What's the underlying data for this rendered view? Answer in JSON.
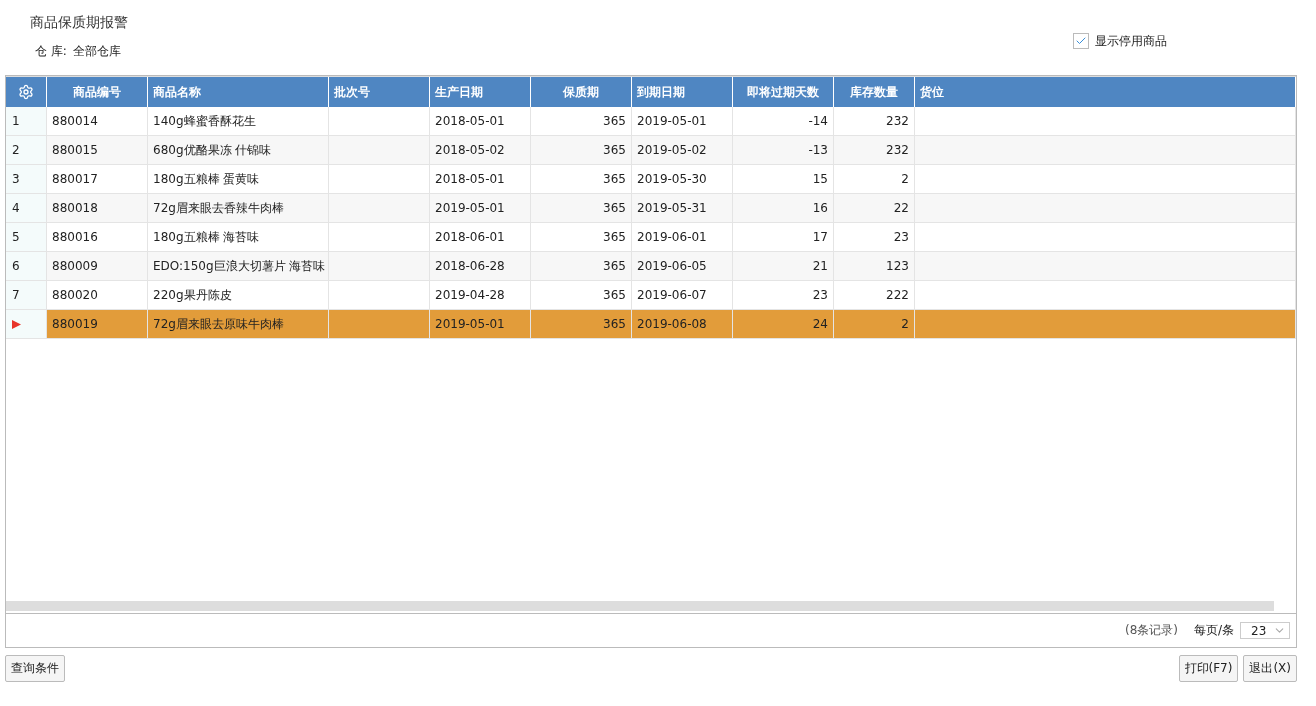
{
  "title": "商品保质期报警",
  "warehouse": {
    "label": "仓 库:",
    "value": "全部仓库"
  },
  "show_disabled": {
    "label": "显示停用商品",
    "checked": true
  },
  "table": {
    "columns": [
      "商品编号",
      "商品名称",
      "批次号",
      "生产日期",
      "保质期",
      "到期日期",
      "即将过期天数",
      "库存数量",
      "货位"
    ],
    "rows": [
      {
        "number": "1",
        "selected": false,
        "cells": [
          "880014",
          "140g蜂蜜香酥花生",
          "",
          "2018-05-01",
          "365",
          "2019-05-01",
          "-14",
          "232",
          ""
        ]
      },
      {
        "number": "2",
        "selected": false,
        "cells": [
          "880015",
          "680g优酪果冻 什锦味",
          "",
          "2018-05-02",
          "365",
          "2019-05-02",
          "-13",
          "232",
          ""
        ]
      },
      {
        "number": "3",
        "selected": false,
        "cells": [
          "880017",
          "180g五粮棒 蛋黄味",
          "",
          "2018-05-01",
          "365",
          "2019-05-30",
          "15",
          "2",
          ""
        ]
      },
      {
        "number": "4",
        "selected": false,
        "cells": [
          "880018",
          "72g眉来眼去香辣牛肉棒",
          "",
          "2019-05-01",
          "365",
          "2019-05-31",
          "16",
          "22",
          ""
        ]
      },
      {
        "number": "5",
        "selected": false,
        "cells": [
          "880016",
          "180g五粮棒 海苔味",
          "",
          "2018-06-01",
          "365",
          "2019-06-01",
          "17",
          "23",
          ""
        ]
      },
      {
        "number": "6",
        "selected": false,
        "cells": [
          "880009",
          "EDO:150g巨浪大切薯片 海苔味",
          "",
          "2018-06-28",
          "365",
          "2019-06-05",
          "21",
          "123",
          ""
        ]
      },
      {
        "number": "7",
        "selected": false,
        "cells": [
          "880020",
          "220g果丹陈皮",
          "",
          "2019-04-28",
          "365",
          "2019-06-07",
          "23",
          "222",
          ""
        ]
      },
      {
        "selected": true,
        "cells": [
          "880019",
          "72g眉来眼去原味牛肉棒",
          "",
          "2019-05-01",
          "365",
          "2019-06-08",
          "24",
          "2",
          ""
        ]
      }
    ]
  },
  "footer": {
    "records": "(8条记录)",
    "page_size_label": "每页/条",
    "page_size": "23"
  },
  "buttons": {
    "left": [
      "查询条件"
    ],
    "right": [
      "打印(F7)",
      "退出(X)"
    ]
  }
}
